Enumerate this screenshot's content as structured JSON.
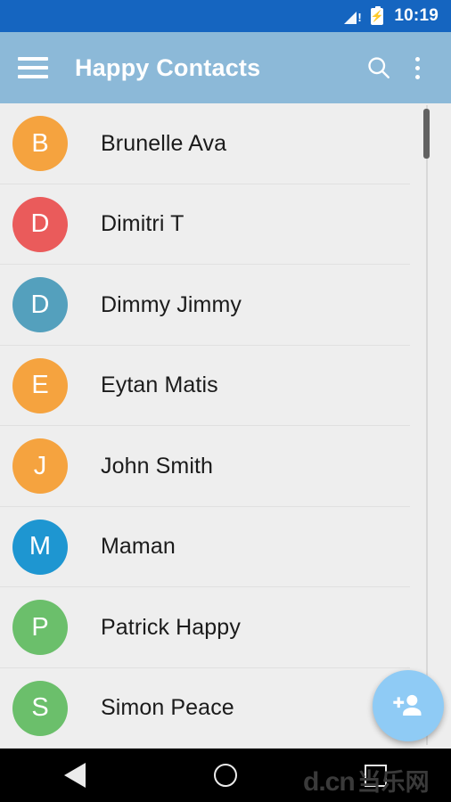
{
  "status_bar": {
    "time": "10:19",
    "signal_icon": "signal-no-service-icon",
    "battery_icon": "battery-charging-icon",
    "background_color": "#1565C0"
  },
  "app_bar": {
    "title": "Happy Contacts",
    "menu_icon": "hamburger-menu-icon",
    "search_icon": "search-icon",
    "overflow_icon": "overflow-menu-icon",
    "background_color": "#8CB9D8"
  },
  "contacts": [
    {
      "name": "Brunelle Ava",
      "initial": "B",
      "color": "#F5A33F"
    },
    {
      "name": "Dimitri T",
      "initial": "D",
      "color": "#EA5B5B"
    },
    {
      "name": "Dimmy Jimmy",
      "initial": "D",
      "color": "#54A0BD"
    },
    {
      "name": "Eytan Matis",
      "initial": "E",
      "color": "#F5A33F"
    },
    {
      "name": "John Smith",
      "initial": "J",
      "color": "#F5A33F"
    },
    {
      "name": "Maman",
      "initial": "M",
      "color": "#1E96D1"
    },
    {
      "name": "Patrick Happy",
      "initial": "P",
      "color": "#6BBF6B"
    },
    {
      "name": "Simon Peace",
      "initial": "S",
      "color": "#6BBF6B"
    }
  ],
  "fab": {
    "icon": "person-add-icon",
    "color": "#8FCBF5"
  },
  "scrollbar": {
    "thumb_color": "#616161"
  },
  "nav_bar": {
    "back_icon": "nav-back-icon",
    "home_icon": "nav-home-icon",
    "recents_icon": "nav-recents-icon",
    "watermark_latin": "d.cn",
    "watermark_cn": "当乐网"
  }
}
